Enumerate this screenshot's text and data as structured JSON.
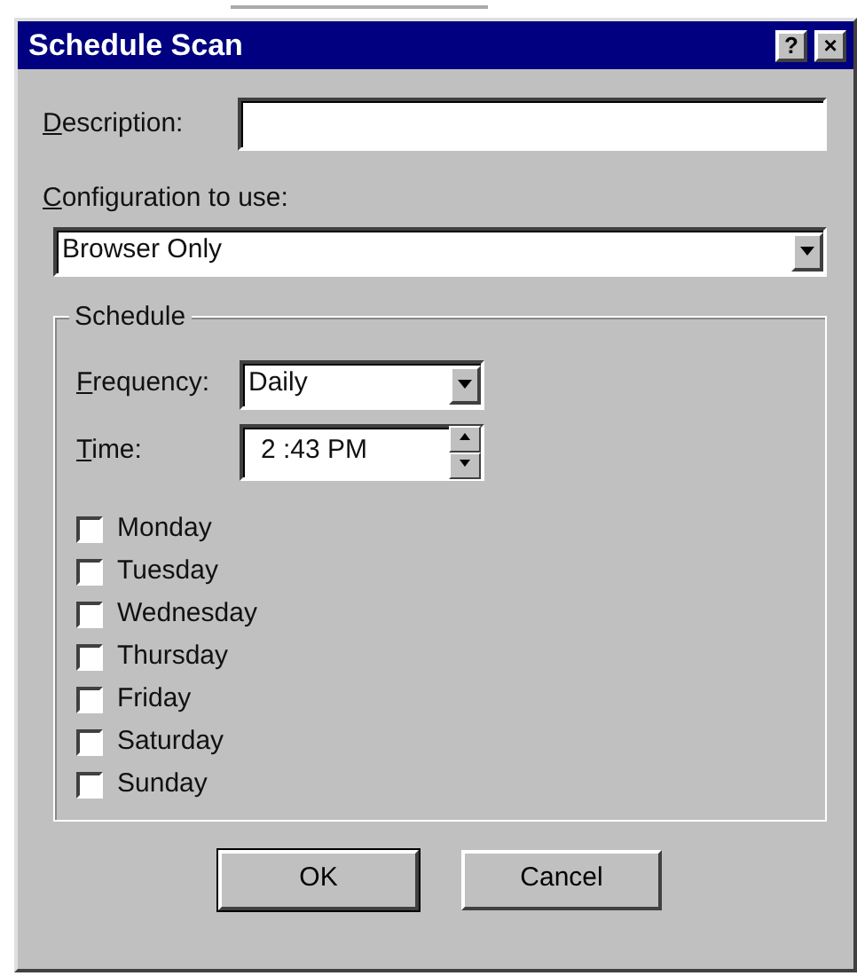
{
  "window": {
    "title": "Schedule Scan",
    "title_buttons": [
      "?",
      "×"
    ]
  },
  "description": {
    "label": "Description:"
  },
  "configuration": {
    "label": "Configuration to use:",
    "value": "Browser Only"
  },
  "schedule": {
    "title": "Schedule",
    "frequency": {
      "label": "Frequency:",
      "value": "Daily"
    },
    "time": {
      "label": "Time:",
      "value": "2 :43 PM"
    },
    "days": [
      {
        "label": "Monday",
        "checked": false
      },
      {
        "label": "Tuesday",
        "checked": false
      },
      {
        "label": "Wednesday",
        "checked": false
      },
      {
        "label": "Thursday",
        "checked": false
      },
      {
        "label": "Friday",
        "checked": false
      },
      {
        "label": "Saturday",
        "checked": false
      },
      {
        "label": "Sunday",
        "checked": false
      }
    ]
  },
  "buttons": [
    {
      "label": "OK",
      "default": true
    },
    {
      "label": "Cancel",
      "default": false
    }
  ]
}
